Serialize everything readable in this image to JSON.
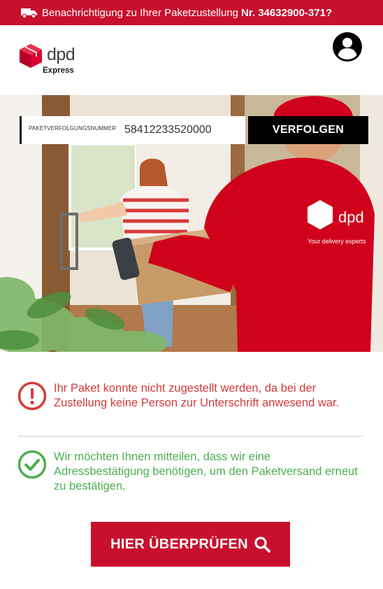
{
  "banner": {
    "text": "Benachrichtigung zu Ihrer Paketzustellung",
    "number": "Nr. 34632900-371?",
    "icon": "truck-icon"
  },
  "header": {
    "brand": "dpd",
    "sub": "Express",
    "account_icon": "user-account-icon"
  },
  "hero": {
    "van_brand": "dpd",
    "van_tagline": "Your delivery experts"
  },
  "tracking": {
    "label": "PAKETVERFOLGUNGSNUMMER",
    "value": "58412233520000",
    "button": "VERFOLGEN"
  },
  "messages": {
    "error": "Ihr Paket konnte nicht zugestellt werden, da bei der Zustellung keine Person zur Unterschrift anwesend war.",
    "ok": "Wir möchten Ihnen mitteilen, dass wir eine Adressbestätigung benötigen, um den Paketversand erneut zu bestätigen."
  },
  "cta": {
    "label": "HIER ÜBERPRÜFEN"
  },
  "colors": {
    "brand_red": "#c8102e",
    "error_red": "#d13b3b",
    "ok_green": "#4caf50"
  }
}
